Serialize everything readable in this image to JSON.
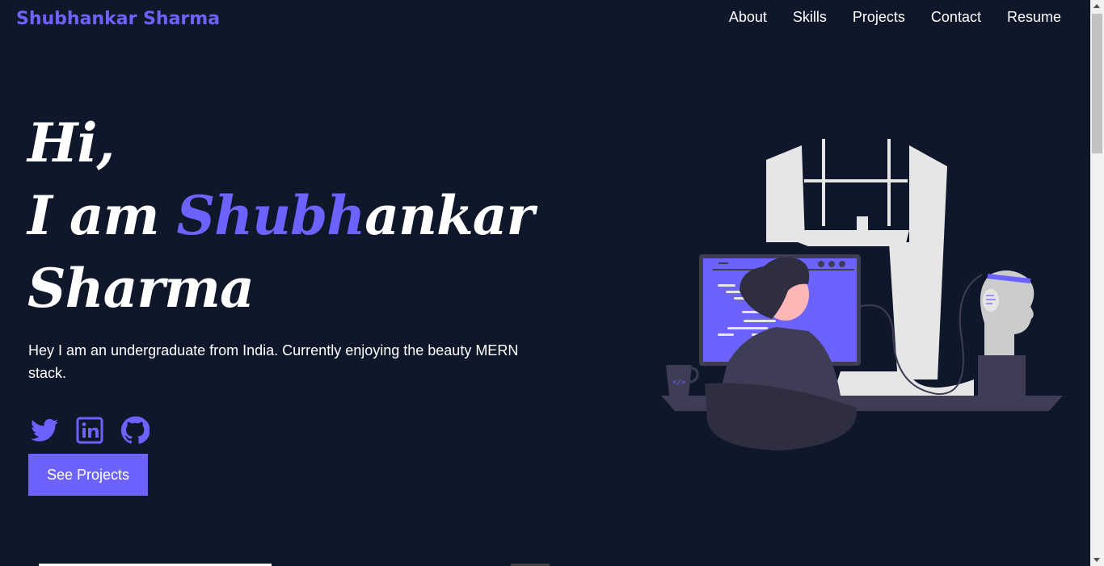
{
  "brand": "Shubhankar Sharma",
  "nav": [
    "About",
    "Skills",
    "Projects",
    "Contact",
    "Resume"
  ],
  "hero": {
    "line1": "Hi,",
    "line2_prefix": "I am ",
    "line2_accent": "Shubh",
    "line2_rest": "ankar",
    "line3": "Sharma",
    "description": "Hey I am an undergraduate from India. Currently enjoying the beauty MERN stack.",
    "cta": "See Projects"
  },
  "socials": [
    "twitter-icon",
    "linkedin-icon",
    "github-icon"
  ],
  "illustration_code_tag": "</>",
  "colors": {
    "background": "#0f172a",
    "accent": "#6c63ff",
    "text": "#ffffff"
  }
}
